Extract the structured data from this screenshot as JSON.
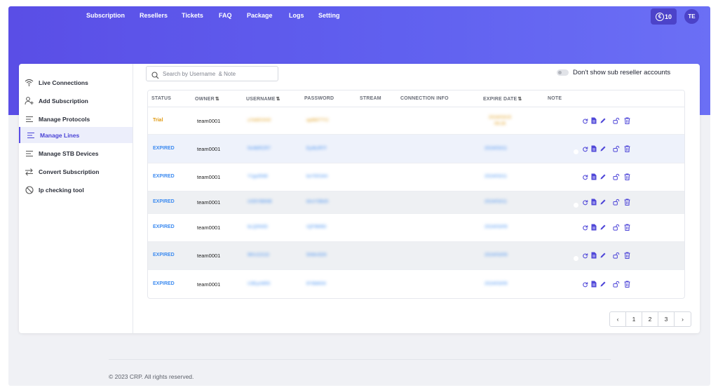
{
  "nav": {
    "items": [
      "Subscription",
      "Resellers",
      "Tickets",
      "FAQ",
      "Package",
      "Logs",
      "Setting"
    ],
    "credits": "10",
    "avatar": "TE"
  },
  "sidebar": {
    "items": [
      {
        "label": "Live Connections",
        "icon": "wifi-icon"
      },
      {
        "label": "Add Subscription",
        "icon": "user-plus-icon"
      },
      {
        "label": "Manage Protocols",
        "icon": "lines-icon"
      },
      {
        "label": "Manage Lines",
        "icon": "lines-icon",
        "active": true
      },
      {
        "label": "Manage STB Devices",
        "icon": "lines-icon"
      },
      {
        "label": "Convert Subscription",
        "icon": "arrows-swap-icon"
      },
      {
        "label": "Ip checking tool",
        "icon": "ban-icon"
      }
    ]
  },
  "search": {
    "placeholder": "Search by Username  & Note"
  },
  "filter": {
    "label": "Don't show sub reseller accounts",
    "enabled": false
  },
  "table": {
    "columns": [
      "STATUS",
      "OWNER",
      "USERNAME",
      "PASSWORD",
      "STREAM",
      "CONNECTION INFO",
      "EXPIRE DATE",
      "NOTE"
    ],
    "rows": [
      {
        "status": "Trial",
        "owner": "team0001",
        "username": "u7eMXXH0",
        "password": "ap8M77Y2",
        "stream": "",
        "connection": "",
        "expire": "2024/03/15 09:26",
        "note": ""
      },
      {
        "status": "EXPIRED",
        "owner": "team0001",
        "username": "Nv4bRCR7",
        "password": "Ey4bJR7f",
        "stream": "",
        "connection": "",
        "expire": "2024/03/11",
        "note": ""
      },
      {
        "status": "EXPIRED",
        "owner": "team0001",
        "username": "Y1gu5N8I",
        "password": "bxY9X34A",
        "stream": "",
        "connection": "",
        "expire": "2024/03/11",
        "note": ""
      },
      {
        "status": "EXPIRED",
        "owner": "team0001",
        "username": "UO5YB6NB",
        "password": "bhsYSBdS",
        "stream": "",
        "connection": "",
        "expire": "2024/03/11",
        "note": ""
      },
      {
        "status": "EXPIRED",
        "owner": "team0001",
        "username": "bLQ0N0D",
        "password": "rQF9M9D",
        "stream": "",
        "connection": "",
        "expire": "2024/03/09",
        "note": ""
      },
      {
        "status": "EXPIRED",
        "owner": "team0001",
        "username": "9KhJ1S1D",
        "password": "5hMvSD9",
        "stream": "",
        "connection": "",
        "expire": "2024/03/09",
        "note": ""
      },
      {
        "status": "EXPIRED",
        "owner": "team0001",
        "username": "U3EycM9S",
        "password": "8Y8bM34",
        "stream": "",
        "connection": "",
        "expire": "2024/03/09",
        "note": ""
      }
    ]
  },
  "pagination": {
    "pages": [
      "1",
      "2",
      "3"
    ],
    "prev": "‹",
    "next": "›"
  },
  "footer": {
    "copyright": "© 2023 CRP. All rights reserved."
  },
  "colors": {
    "brand": "#5a4ee6",
    "trial": "#e09a12",
    "expired": "#3d8bf0",
    "row_alt": "#eef2fb"
  }
}
